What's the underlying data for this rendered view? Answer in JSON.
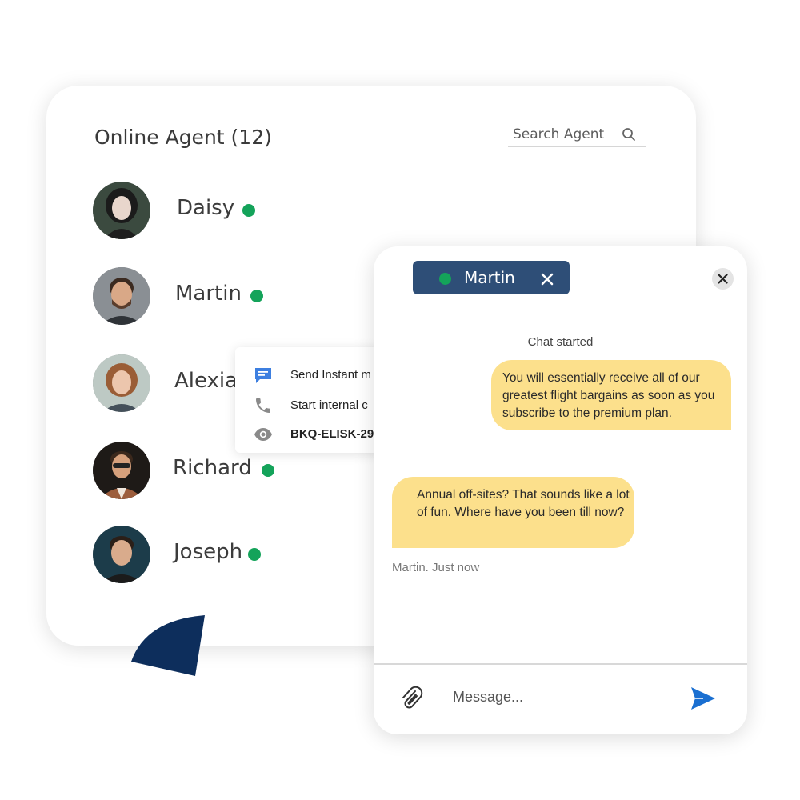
{
  "colors": {
    "online": "#14a35a",
    "chat_tab_bg": "#2e4e77",
    "bubble": "#fce08c",
    "send_blue": "#1a6fd1",
    "deco_navy": "#0d2e5c"
  },
  "agent_panel": {
    "title": "Online Agent (12)",
    "search_placeholder": "Search Agent",
    "search_icon": "search-icon",
    "agents": [
      {
        "name": "Daisy",
        "status": "online"
      },
      {
        "name": "Martin",
        "status": "online"
      },
      {
        "name": "Alexia",
        "status": "online"
      },
      {
        "name": "Richard",
        "status": "online"
      },
      {
        "name": "Joseph",
        "status": "online"
      }
    ]
  },
  "context_menu": {
    "items": [
      {
        "label": "Send Instant m",
        "icon": "message-icon"
      },
      {
        "label": "Start internal c",
        "icon": "phone-icon"
      },
      {
        "label": "BKQ-ELISK-29",
        "icon": "eye-icon"
      }
    ]
  },
  "chat": {
    "tab_name": "Martin",
    "started_label": "Chat started",
    "outgoing_message": "You will essentially receive all of our greatest flight bargains as soon as you subscribe to the premium plan.",
    "incoming_message": "Annual off-sites? That sounds like a lot of fun. Where have you been till now?",
    "incoming_meta": "Martin. Just now",
    "message_placeholder": "Message..."
  }
}
